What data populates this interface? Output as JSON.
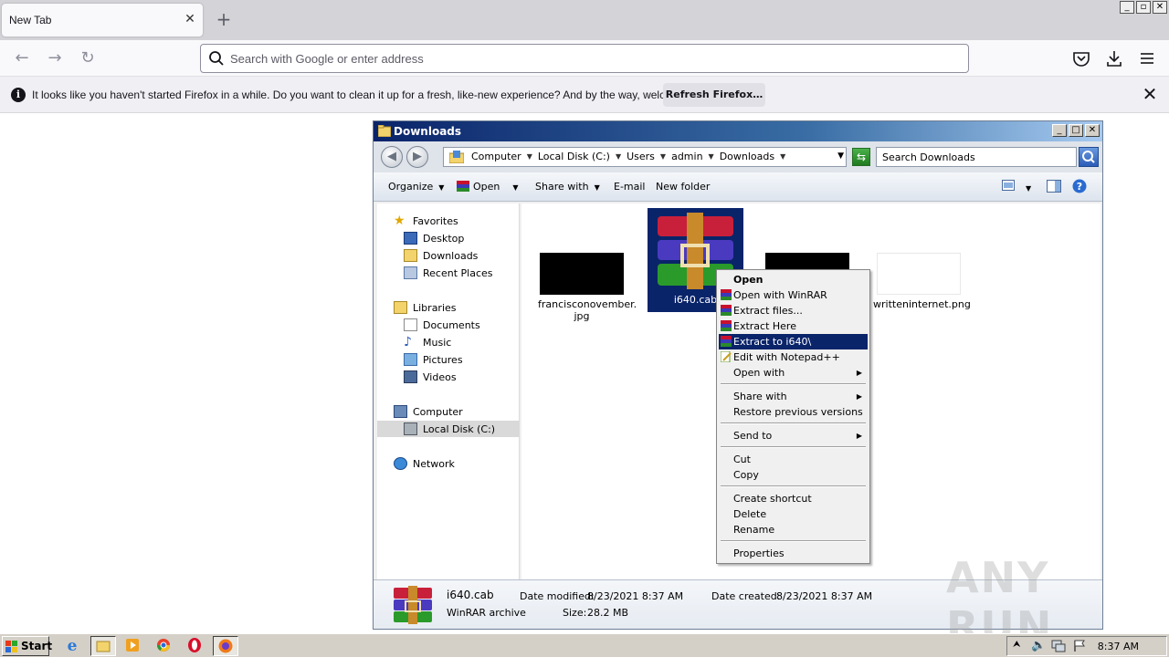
{
  "browser": {
    "tab_title": "New Tab",
    "url_placeholder": "Search with Google or enter address",
    "notification": {
      "message": "It looks like you haven't started Firefox in a while. Do you want to clean it up for a fresh, like-new experience? And by the way, welcome back!",
      "button": "Refresh Firefox…"
    }
  },
  "explorer": {
    "title": "Downloads",
    "breadcrumb": [
      "Computer",
      "Local Disk (C:)",
      "Users",
      "admin",
      "Downloads"
    ],
    "search_placeholder": "Search Downloads",
    "toolbar": {
      "organize": "Organize",
      "open": "Open",
      "share_with": "Share with",
      "email": "E-mail",
      "new_folder": "New folder"
    },
    "nav": {
      "favorites": "Favorites",
      "desktop": "Desktop",
      "downloads": "Downloads",
      "recent_places": "Recent Places",
      "libraries": "Libraries",
      "documents": "Documents",
      "music": "Music",
      "pictures": "Pictures",
      "videos": "Videos",
      "computer": "Computer",
      "local_disk": "Local Disk (C:)",
      "network": "Network"
    },
    "files": [
      {
        "name_line1": "francisconovember.",
        "name_line2": "jpg"
      },
      {
        "name_line1": "i640.cab",
        "name_line2": ""
      },
      {
        "name_line1": "",
        "name_line2": ""
      },
      {
        "name_line1": "writteninternet.png",
        "name_line2": ""
      }
    ],
    "details": {
      "filename": "i640.cab",
      "filetype": "WinRAR archive",
      "modified_label": "Date modified:",
      "modified_value": "8/23/2021 8:37 AM",
      "size_label": "Size:",
      "size_value": "28.2 MB",
      "created_label": "Date created:",
      "created_value": "8/23/2021 8:37 AM"
    }
  },
  "context_menu": {
    "open": "Open",
    "open_winrar": "Open with WinRAR",
    "extract_files": "Extract files...",
    "extract_here": "Extract Here",
    "extract_to": "Extract to i640\\",
    "edit_notepad": "Edit with Notepad++",
    "open_with": "Open with",
    "share_with": "Share with",
    "restore": "Restore previous versions",
    "send_to": "Send to",
    "cut": "Cut",
    "copy": "Copy",
    "create_shortcut": "Create shortcut",
    "delete": "Delete",
    "rename": "Rename",
    "properties": "Properties"
  },
  "taskbar": {
    "start": "Start",
    "clock": "8:37 AM"
  },
  "watermark": "ANY RUN",
  "colors": {
    "menu_highlight": "#0a246a",
    "title_bar": "#0a246a"
  }
}
